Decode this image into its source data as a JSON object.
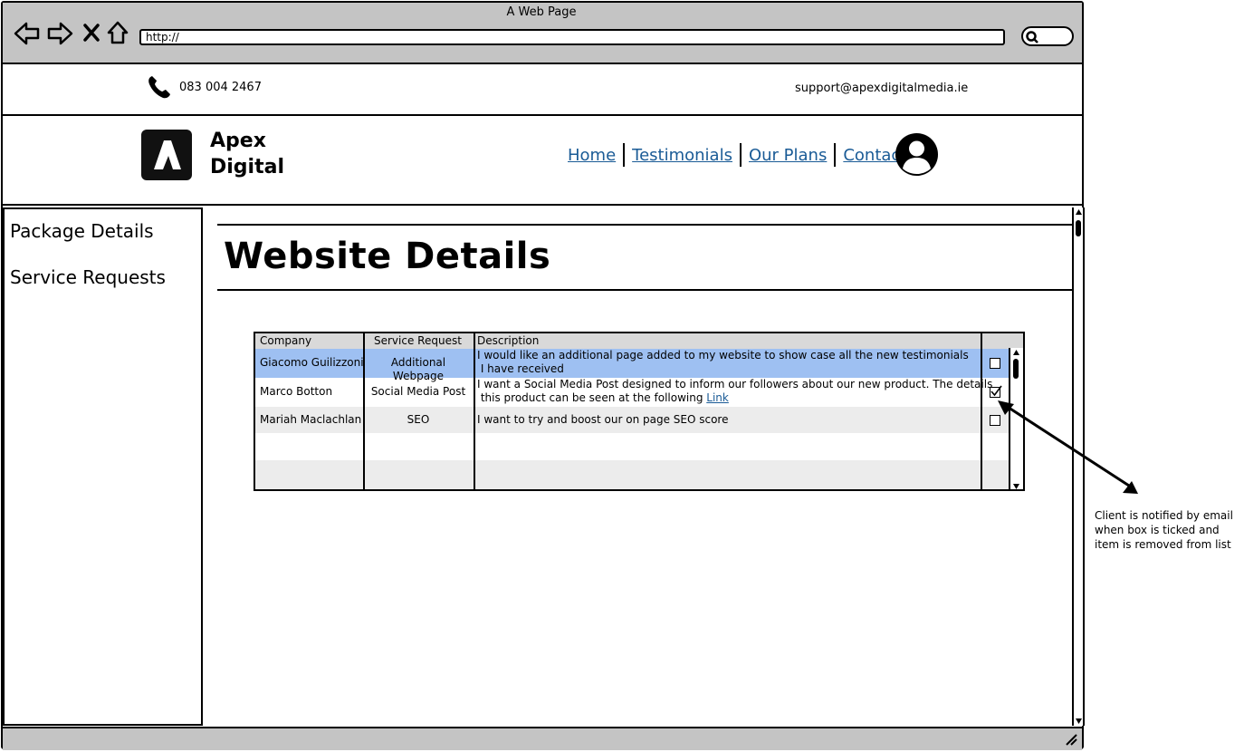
{
  "browser": {
    "window_title": "A Web Page",
    "url": "http://",
    "icons": [
      "back-arrow-icon",
      "forward-arrow-icon",
      "close-x-icon",
      "home-icon",
      "search-icon"
    ]
  },
  "contact": {
    "phone": "083 004 2467",
    "email": "support@apexdigitalmedia.ie"
  },
  "header": {
    "brand_line1": "Apex",
    "brand_line2": "Digital",
    "nav": [
      "Home",
      "Testimonials",
      "Our Plans",
      "Contact"
    ]
  },
  "sidebar": {
    "items": [
      "Package Details",
      "Service Requests"
    ]
  },
  "main": {
    "title": "Website Details"
  },
  "table": {
    "headers": [
      "Company",
      "Service Request",
      "Description"
    ],
    "rows": [
      {
        "company": "Giacomo Guilizzoni",
        "service": "Additional Webpage",
        "description_1": "I would like an additional page added to my website to show case all the new testimonials",
        "description_2": " I have received",
        "checked": false,
        "selected": true
      },
      {
        "company": "Marco Botton",
        "service": "Social Media Post",
        "description_1": "I want a Social Media Post designed to inform our followers about our new product. The details",
        "description_2": " this product can be seen at the following",
        "link": "Link",
        "checked": true,
        "selected": false
      },
      {
        "company": "Mariah Maclachlan",
        "service": "SEO",
        "description_1": "I want to try and boost our on page SEO score",
        "checked": false,
        "selected": false
      }
    ]
  },
  "annotation": {
    "text": "Client is notified by email when box is ticked and item is removed from list"
  },
  "colors": {
    "chrome": "#c4c4c4",
    "link": "#1a5b96",
    "selected_row": "#9ec0f2",
    "alt_row": "#ececec"
  }
}
